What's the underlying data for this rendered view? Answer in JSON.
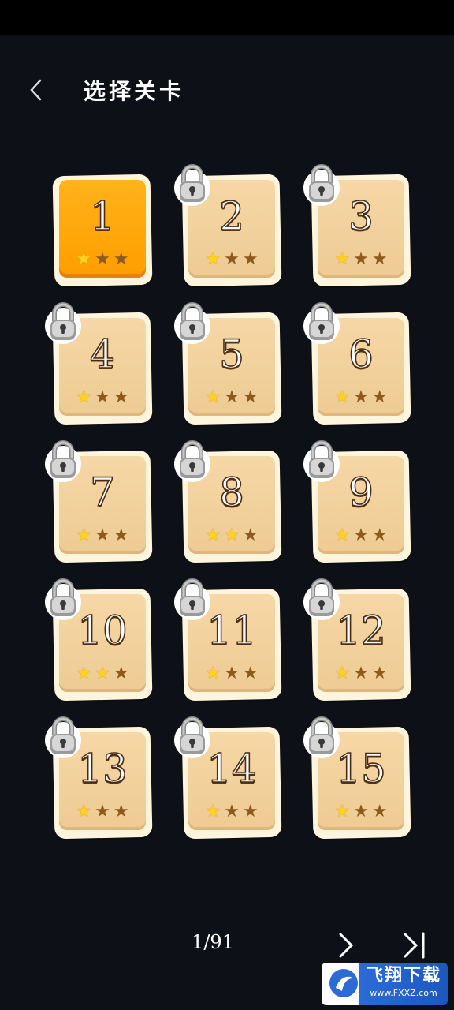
{
  "header": {
    "back_icon": "chevron-left-icon",
    "title": "选择关卡"
  },
  "levels": [
    {
      "num": "1",
      "stars": 1,
      "locked": false
    },
    {
      "num": "2",
      "stars": 1,
      "locked": true
    },
    {
      "num": "3",
      "stars": 1,
      "locked": true
    },
    {
      "num": "4",
      "stars": 1,
      "locked": true
    },
    {
      "num": "5",
      "stars": 1,
      "locked": true
    },
    {
      "num": "6",
      "stars": 1,
      "locked": true
    },
    {
      "num": "7",
      "stars": 1,
      "locked": true
    },
    {
      "num": "8",
      "stars": 2,
      "locked": true
    },
    {
      "num": "9",
      "stars": 1,
      "locked": true
    },
    {
      "num": "10",
      "stars": 2,
      "locked": true
    },
    {
      "num": "11",
      "stars": 1,
      "locked": true
    },
    {
      "num": "12",
      "stars": 1,
      "locked": true
    },
    {
      "num": "13",
      "stars": 1,
      "locked": true
    },
    {
      "num": "14",
      "stars": 1,
      "locked": true
    },
    {
      "num": "15",
      "stars": 1,
      "locked": true
    }
  ],
  "max_stars": 3,
  "footer": {
    "page": "1/91",
    "next_icon": "chevron-right-icon",
    "last_icon": "skip-to-last-icon"
  },
  "watermark": {
    "name": "飞翔下载",
    "url": "www.FXXZ.com"
  },
  "colors": {
    "background": "#0d1016",
    "unlocked_tile": "#ffa500",
    "locked_tile": "#f2d09b",
    "star_on": "#ffd21f",
    "star_off": "#8e5a1c"
  }
}
